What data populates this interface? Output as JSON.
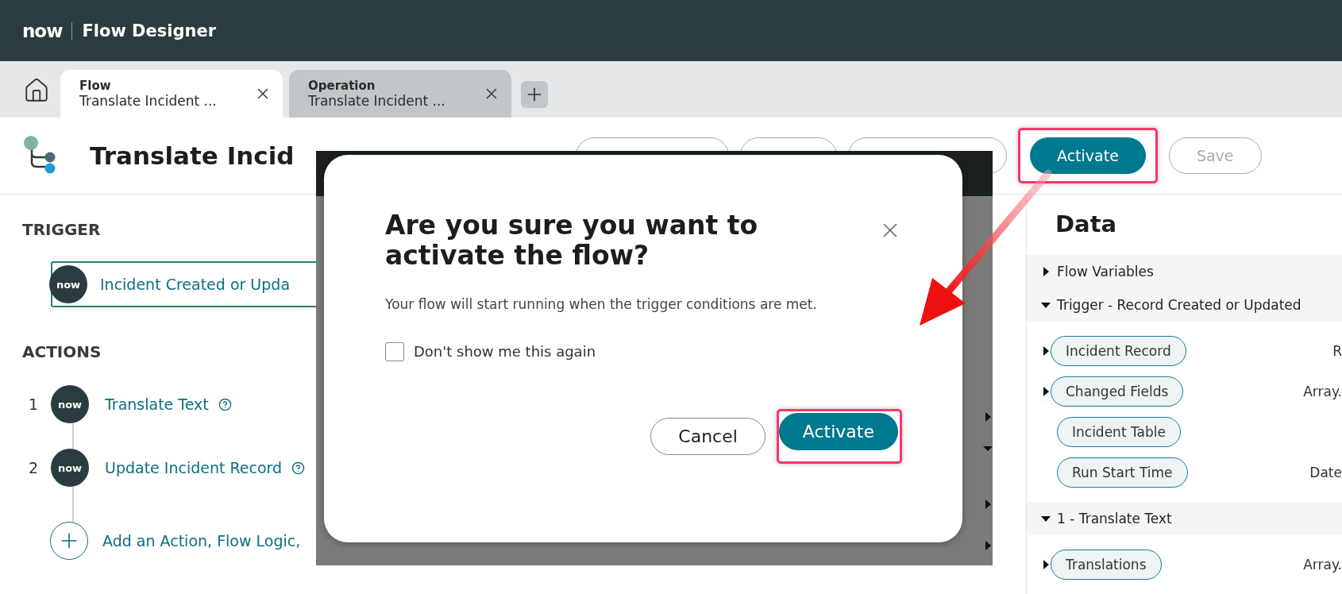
{
  "app": {
    "brand": "now",
    "title": "Flow Designer"
  },
  "tabs": [
    {
      "heading": "Flow",
      "label": "Translate Incident ...",
      "selected": true
    },
    {
      "heading": "Operation",
      "label": "Translate Incident ...",
      "selected": false
    }
  ],
  "toolbar": {
    "title": "Translate Incid",
    "buttons": [
      {
        "kind": "outline"
      },
      {
        "kind": "outline"
      },
      {
        "kind": "outline"
      },
      {
        "label": "Activate",
        "kind": "primary",
        "highlighted": true
      },
      {
        "label": "Save",
        "kind": "outline",
        "disabled": true
      }
    ]
  },
  "trigger": {
    "heading": "TRIGGER",
    "badge": "now",
    "label": "Incident Created or Upda"
  },
  "actions": {
    "heading": "ACTIONS",
    "items": [
      {
        "number": "1",
        "badge": "now",
        "label": "Translate Text",
        "help": true
      },
      {
        "number": "2",
        "badge": "now",
        "label": "Update Incident Record",
        "help": true
      }
    ],
    "add": {
      "label": "Add an Action, Flow Logic,"
    }
  },
  "dialog": {
    "title": "Are you sure you want to activate the flow?",
    "message": "Your flow will start running when the trigger conditions are met.",
    "checkbox": {
      "label": "Don't show me this again",
      "checked": false
    },
    "buttons": [
      {
        "label": "Cancel",
        "kind": "secondary"
      },
      {
        "label": "Activate",
        "kind": "primary",
        "highlighted": true
      }
    ]
  },
  "data_panel": {
    "title": "Data",
    "sections": [
      {
        "label": "Flow Variables",
        "expanded": false
      },
      {
        "label": "Trigger - Record Created or Updated",
        "expanded": true,
        "items": [
          {
            "label": "Incident Record",
            "type": "R",
            "expandable": true
          },
          {
            "label": "Changed Fields",
            "type": "Array.",
            "expandable": true
          },
          {
            "label": "Incident Table",
            "expandable": false
          },
          {
            "label": "Run Start Time",
            "type": "Date",
            "expandable": false
          }
        ]
      },
      {
        "label": "1 - Translate Text",
        "expanded": true,
        "items": [
          {
            "label": "Translations",
            "type": "Array.",
            "expandable": true
          }
        ]
      }
    ]
  }
}
